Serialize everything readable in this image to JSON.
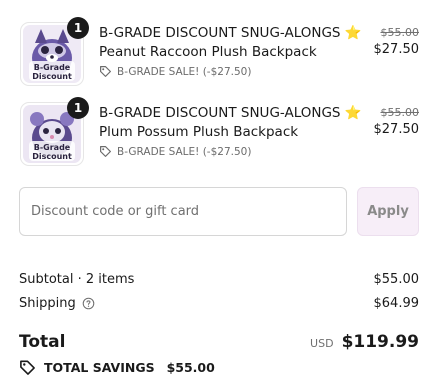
{
  "items": [
    {
      "quantity": "1",
      "title_main": "B-GRADE DISCOUNT SNUG-ALONGS",
      "star": "⭐",
      "title_rest": "Peanut Raccoon Plush Backpack",
      "discount_text": "B-GRADE SALE! (-$27.50)",
      "original_price": "$55.00",
      "final_price": "$27.50",
      "thumb_text": [
        "B-Grade",
        "Discount"
      ],
      "thumb_color": "#6a5aa8"
    },
    {
      "quantity": "1",
      "title_main": "B-GRADE DISCOUNT SNUG-ALONGS",
      "star": "⭐",
      "title_rest": "Plum Possum Plush Backpack",
      "discount_text": "B-GRADE SALE! (-$27.50)",
      "original_price": "$55.00",
      "final_price": "$27.50",
      "thumb_text": [
        "B-Grade",
        "Discount"
      ],
      "thumb_color": "#5a4a8e"
    }
  ],
  "discount": {
    "placeholder": "Discount code or gift card",
    "apply_label": "Apply"
  },
  "summary": {
    "subtotal_label": "Subtotal · 2 items",
    "subtotal_value": "$55.00",
    "shipping_label": "Shipping",
    "shipping_value": "$64.99",
    "total_label": "Total",
    "currency": "USD",
    "total_value": "$119.99",
    "savings_label": "TOTAL SAVINGS",
    "savings_value": "$55.00"
  },
  "icons": {
    "tag": "tag-icon",
    "help": "help-circle-icon",
    "savings": "savings-tag-icon"
  }
}
